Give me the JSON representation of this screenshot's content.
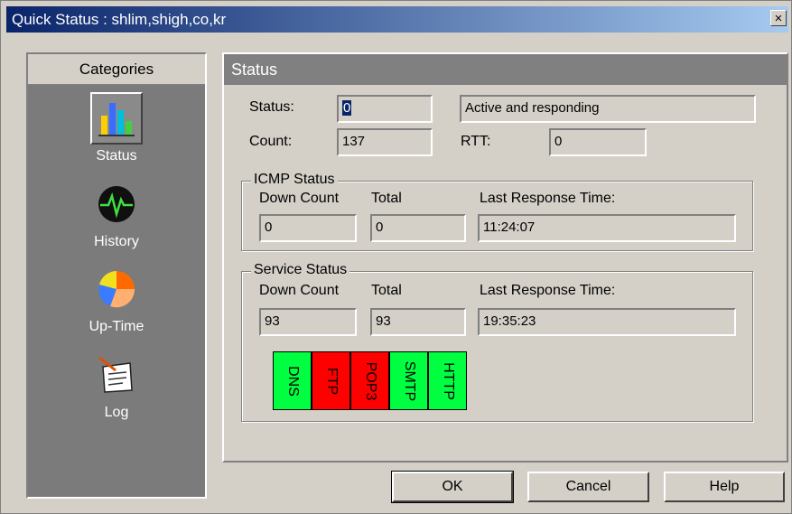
{
  "window": {
    "title": "Quick Status : shlim,shigh,co,kr",
    "close_label": "×"
  },
  "sidebar": {
    "header": "Categories",
    "items": [
      {
        "label": "Status",
        "icon": "bar-chart-icon",
        "selected": true
      },
      {
        "label": "History",
        "icon": "heartbeat-icon",
        "selected": false
      },
      {
        "label": "Up-Time",
        "icon": "pie-chart-icon",
        "selected": false
      },
      {
        "label": "Log",
        "icon": "notepad-icon",
        "selected": false
      }
    ]
  },
  "panel": {
    "title": "Status",
    "status_label": "Status:",
    "status_value": "0",
    "status_text": "Active and responding",
    "count_label": "Count:",
    "count_value": "137",
    "rtt_label": "RTT:",
    "rtt_value": "0",
    "icmp": {
      "title": "ICMP Status",
      "down_label": "Down Count",
      "total_label": "Total",
      "last_label": "Last Response Time:",
      "down_value": "0",
      "total_value": "0",
      "last_value": "11:24:07"
    },
    "service": {
      "title": "Service Status",
      "down_label": "Down Count",
      "total_label": "Total",
      "last_label": "Last Response Time:",
      "down_value": "93",
      "total_value": "93",
      "last_value": "19:35:23",
      "services": [
        {
          "name": "DNS",
          "status": "up",
          "color": "#00ff40"
        },
        {
          "name": "FTP",
          "status": "down",
          "color": "#ff0000"
        },
        {
          "name": "POP3",
          "status": "down",
          "color": "#ff0000"
        },
        {
          "name": "SMTP",
          "status": "up",
          "color": "#00ff40"
        },
        {
          "name": "HTTP",
          "status": "up",
          "color": "#00ff40"
        }
      ]
    }
  },
  "buttons": {
    "ok": "OK",
    "cancel": "Cancel",
    "help": "Help"
  }
}
